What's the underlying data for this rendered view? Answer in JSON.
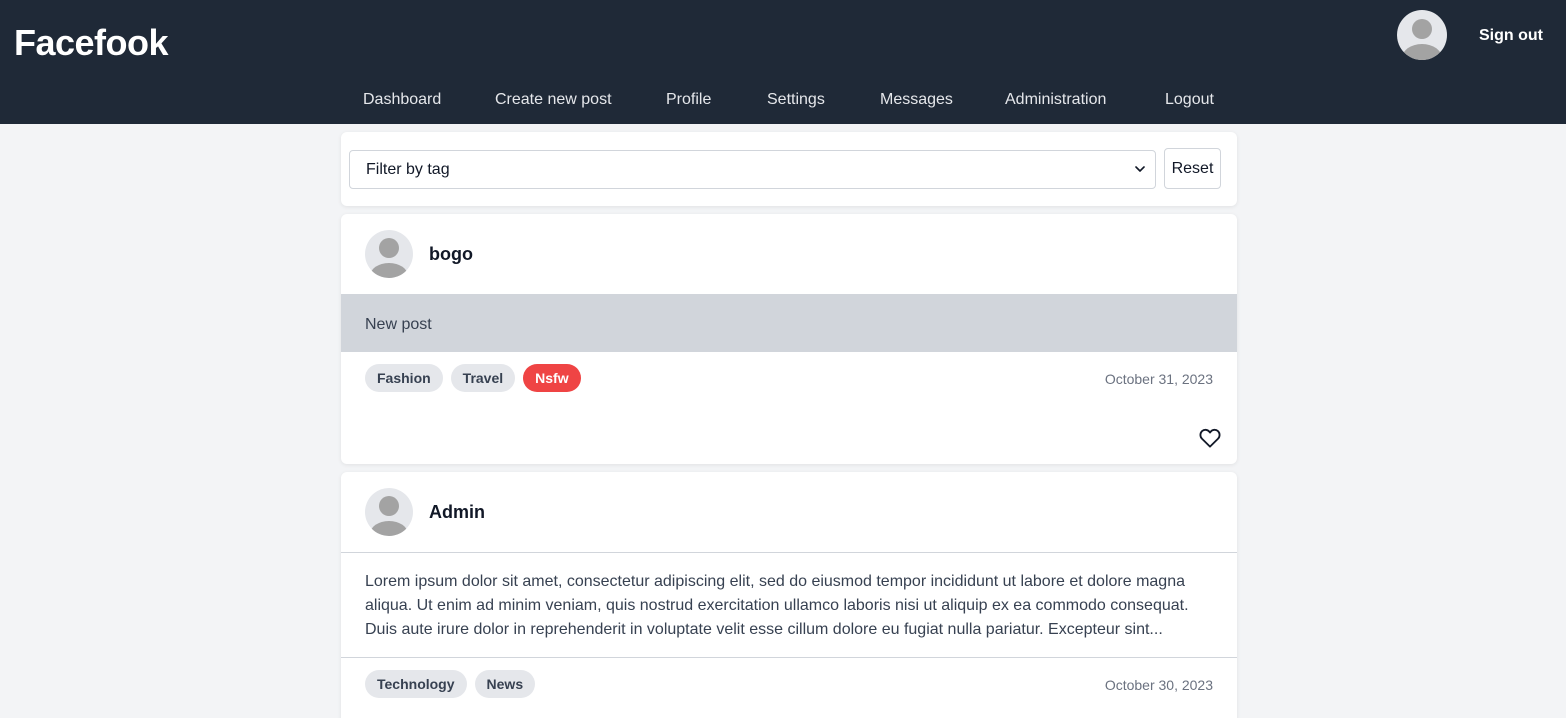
{
  "header": {
    "logo": "Facefook",
    "sign_out": "Sign out",
    "nav": [
      "Dashboard",
      "Create new post",
      "Profile",
      "Settings",
      "Messages",
      "Administration",
      "Logout"
    ]
  },
  "filter": {
    "select_value": "Filter by tag",
    "reset_label": "Reset"
  },
  "posts": [
    {
      "author": "bogo",
      "content": "New post",
      "tags": [
        "Fashion",
        "Travel",
        "Nsfw"
      ],
      "date": "October 31, 2023"
    },
    {
      "author": "Admin",
      "content": "Lorem ipsum dolor sit amet, consectetur adipiscing elit, sed do eiusmod tempor incididunt ut labore et dolore magna aliqua. Ut enim ad minim veniam, quis nostrud exercitation ullamco laboris nisi ut aliquip ex ea commodo consequat. Duis aute irure dolor in reprehenderit in voluptate velit esse cillum dolore eu fugiat nulla pariatur. Excepteur sint...",
      "tags": [
        "Technology",
        "News"
      ],
      "date": "October 30, 2023"
    }
  ],
  "colors": {
    "header_bg": "#1f2937",
    "page_bg": "#f3f4f6",
    "nsfw_tag": "#ef4444",
    "tag_bg": "#e5e7eb"
  },
  "icons": {
    "avatar": "user-avatar-icon",
    "heart": "heart-outline-icon",
    "select_chevron": "chevron-down-icon"
  }
}
